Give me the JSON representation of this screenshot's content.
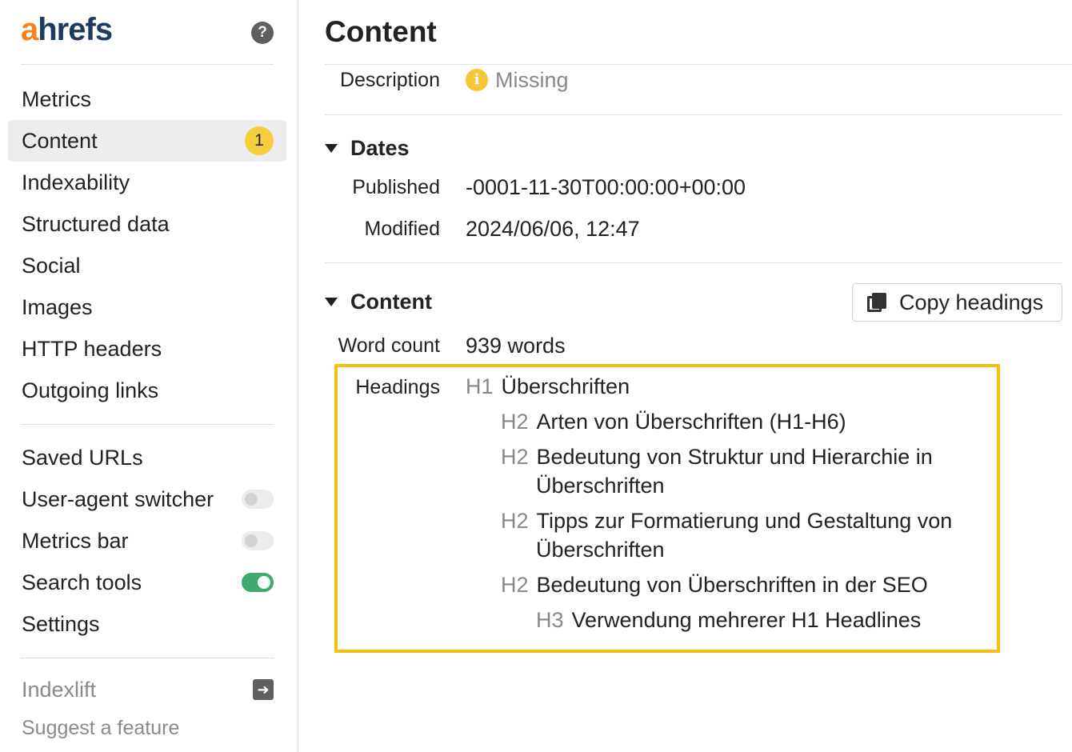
{
  "sidebar": {
    "logo_a": "a",
    "logo_rest": "hrefs",
    "help_icon": "question-circle-icon",
    "nav": [
      {
        "label": "Metrics"
      },
      {
        "label": "Content",
        "badge": "1"
      },
      {
        "label": "Indexability"
      },
      {
        "label": "Structured data"
      },
      {
        "label": "Social"
      },
      {
        "label": "Images"
      },
      {
        "label": "HTTP headers"
      },
      {
        "label": "Outgoing links"
      }
    ],
    "tools": [
      {
        "label": "Saved URLs"
      },
      {
        "label": "User-agent switcher",
        "toggle": false
      },
      {
        "label": "Metrics bar",
        "toggle": false
      },
      {
        "label": "Search tools",
        "toggle": true
      },
      {
        "label": "Settings"
      }
    ],
    "footer": [
      {
        "label": "Indexlift",
        "icon": "exit-arrow-icon"
      },
      {
        "label": "Suggest a feature"
      }
    ]
  },
  "main": {
    "title": "Content",
    "description": {
      "label": "Description",
      "value": "Missing",
      "icon": "info-icon"
    },
    "dates": {
      "title": "Dates",
      "published": {
        "label": "Published",
        "value": "-0001-11-30T00:00:00+00:00"
      },
      "modified": {
        "label": "Modified",
        "value": "2024/06/06, 12:47"
      }
    },
    "content": {
      "title": "Content",
      "copy_button": "Copy headings",
      "word_count": {
        "label": "Word count",
        "value": "939 words"
      },
      "headings_label": "Headings",
      "headings": [
        {
          "tag": "H1",
          "text": "Überschriften"
        },
        {
          "tag": "H2",
          "text": "Arten von Überschriften (H1-H6)"
        },
        {
          "tag": "H2",
          "line1": "Bedeutung von Struktur und Hierarchie in",
          "line2": "Überschriften"
        },
        {
          "tag": "H2",
          "line1": "Tipps zur Formatierung und Gestaltung von",
          "line2": "Überschriften"
        },
        {
          "tag": "H2",
          "text": "Bedeutung von Überschriften in der SEO"
        },
        {
          "tag": "H3",
          "text": "Verwendung mehrerer H1 Headlines"
        }
      ]
    },
    "colors": {
      "highlight_border": "#f5bf10",
      "badge": "#f6cd3b",
      "toggle_on": "#3fa96b",
      "logo_orange": "#f58220",
      "logo_navy": "#1e3a5f"
    }
  }
}
